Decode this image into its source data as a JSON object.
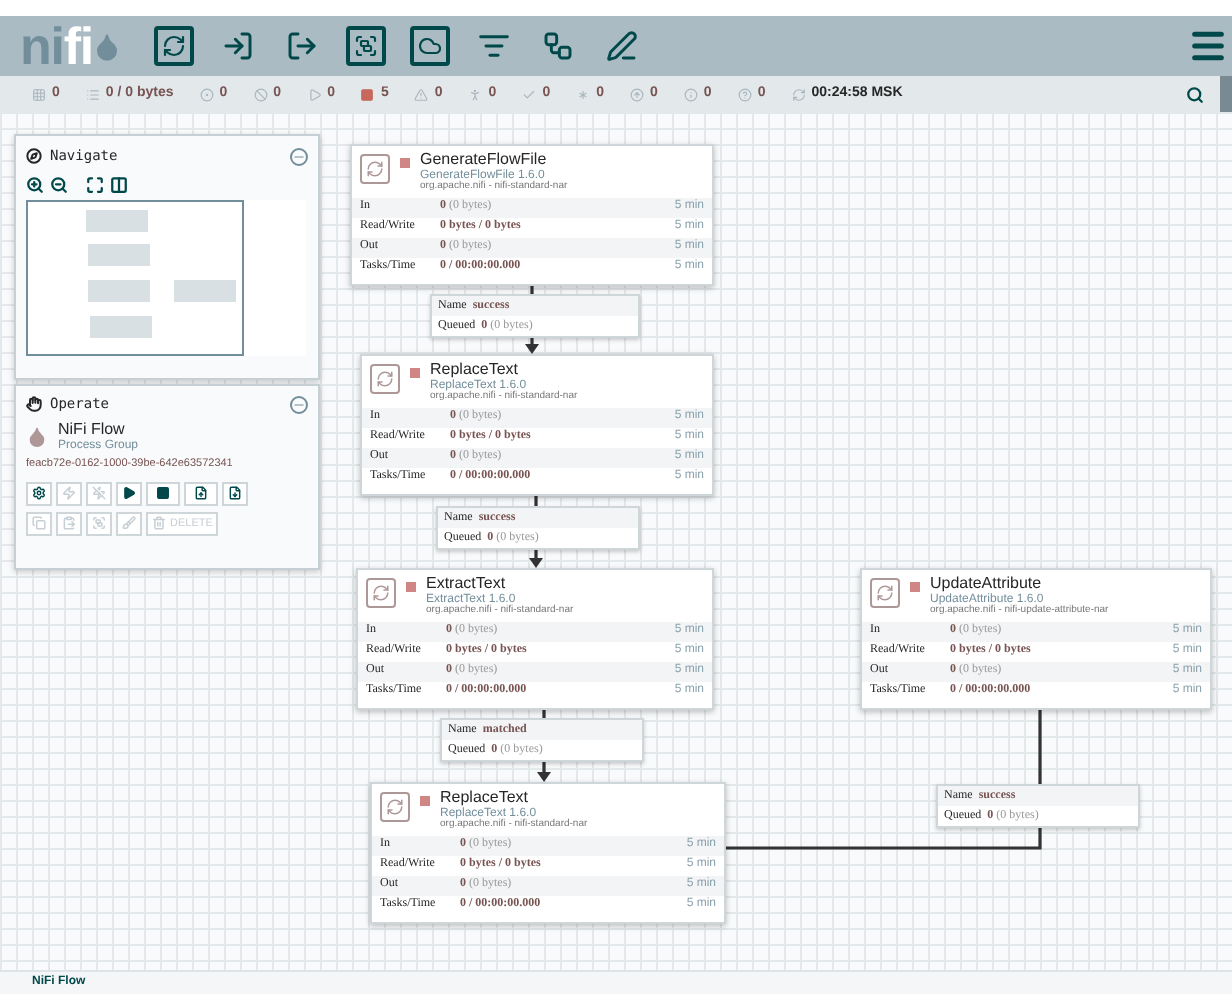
{
  "logo": {
    "dark": "ni",
    "light": "fi"
  },
  "status": [
    {
      "kind": "threads",
      "text": "0"
    },
    {
      "kind": "queued",
      "text": "0 / 0 bytes"
    },
    {
      "kind": "transmitting",
      "text": "0"
    },
    {
      "kind": "not_transmitting",
      "text": "0"
    },
    {
      "kind": "running",
      "text": "0"
    },
    {
      "kind": "stopped",
      "text": "5"
    },
    {
      "kind": "invalid",
      "text": "0"
    },
    {
      "kind": "disabled",
      "text": "0"
    },
    {
      "kind": "up_to_date",
      "text": "0"
    },
    {
      "kind": "locally_modified",
      "text": "0"
    },
    {
      "kind": "stale",
      "text": "0"
    },
    {
      "kind": "modified_stale",
      "text": "0"
    },
    {
      "kind": "sync_failure",
      "text": "0"
    },
    {
      "kind": "refresh",
      "text": "00:24:58 MSK"
    }
  ],
  "navigate": {
    "title": "Navigate"
  },
  "operate": {
    "title": "Operate",
    "name": "NiFi Flow",
    "type": "Process Group",
    "id": "feacb72e-0162-1000-39be-642e63572341",
    "buttons": [
      {
        "kind": "configure",
        "disabled": false
      },
      {
        "kind": "enable",
        "disabled": true
      },
      {
        "kind": "disable",
        "disabled": true
      },
      {
        "kind": "start",
        "disabled": false
      },
      {
        "kind": "stop",
        "disabled": false
      },
      {
        "kind": "create_template",
        "disabled": false
      },
      {
        "kind": "upload_template",
        "disabled": false
      },
      {
        "kind": "copy",
        "disabled": true
      },
      {
        "kind": "paste",
        "disabled": true
      },
      {
        "kind": "group",
        "disabled": true
      },
      {
        "kind": "color",
        "disabled": true
      },
      {
        "kind": "delete",
        "disabled": true,
        "label": "DELETE"
      }
    ]
  },
  "processors": [
    {
      "name": "GenerateFlowFile",
      "type": "GenerateFlowFile 1.6.0",
      "bundle": "org.apache.nifi - nifi-standard-nar",
      "stopped": true,
      "stats": [
        {
          "label": "In",
          "value": "0",
          "detail": "(0 bytes)",
          "window": "5 min"
        },
        {
          "label": "Read/Write",
          "value": "0 bytes / 0 bytes",
          "window": "5 min"
        },
        {
          "label": "Out",
          "value": "0",
          "detail": "(0 bytes)",
          "window": "5 min"
        },
        {
          "label": "Tasks/Time",
          "value": "0 / 00:00:00.000",
          "window": "5 min"
        }
      ]
    },
    {
      "name": "ReplaceText",
      "type": "ReplaceText 1.6.0",
      "bundle": "org.apache.nifi - nifi-standard-nar",
      "stopped": true,
      "stats": [
        {
          "label": "In",
          "value": "0",
          "detail": "(0 bytes)",
          "window": "5 min"
        },
        {
          "label": "Read/Write",
          "value": "0 bytes / 0 bytes",
          "window": "5 min"
        },
        {
          "label": "Out",
          "value": "0",
          "detail": "(0 bytes)",
          "window": "5 min"
        },
        {
          "label": "Tasks/Time",
          "value": "0 / 00:00:00.000",
          "window": "5 min"
        }
      ]
    },
    {
      "name": "ExtractText",
      "type": "ExtractText 1.6.0",
      "bundle": "org.apache.nifi - nifi-standard-nar",
      "stopped": true,
      "stats": [
        {
          "label": "In",
          "value": "0",
          "detail": "(0 bytes)",
          "window": "5 min"
        },
        {
          "label": "Read/Write",
          "value": "0 bytes / 0 bytes",
          "window": "5 min"
        },
        {
          "label": "Out",
          "value": "0",
          "detail": "(0 bytes)",
          "window": "5 min"
        },
        {
          "label": "Tasks/Time",
          "value": "0 / 00:00:00.000",
          "window": "5 min"
        }
      ]
    },
    {
      "name": "ReplaceText",
      "type": "ReplaceText 1.6.0",
      "bundle": "org.apache.nifi - nifi-standard-nar",
      "stopped": true,
      "stats": [
        {
          "label": "In",
          "value": "0",
          "detail": "(0 bytes)",
          "window": "5 min"
        },
        {
          "label": "Read/Write",
          "value": "0 bytes / 0 bytes",
          "window": "5 min"
        },
        {
          "label": "Out",
          "value": "0",
          "detail": "(0 bytes)",
          "window": "5 min"
        },
        {
          "label": "Tasks/Time",
          "value": "0 / 00:00:00.000",
          "window": "5 min"
        }
      ]
    },
    {
      "name": "UpdateAttribute",
      "type": "UpdateAttribute 1.6.0",
      "bundle": "org.apache.nifi - nifi-update-attribute-nar",
      "stopped": true,
      "stats": [
        {
          "label": "In",
          "value": "0",
          "detail": "(0 bytes)",
          "window": "5 min"
        },
        {
          "label": "Read/Write",
          "value": "0 bytes / 0 bytes",
          "window": "5 min"
        },
        {
          "label": "Out",
          "value": "0",
          "detail": "(0 bytes)",
          "window": "5 min"
        },
        {
          "label": "Tasks/Time",
          "value": "0 / 00:00:00.000",
          "window": "5 min"
        }
      ]
    }
  ],
  "connections": [
    {
      "name_label": "Name",
      "name": "success",
      "queued_label": "Queued",
      "queued": "0",
      "queued_detail": "(0 bytes)"
    },
    {
      "name_label": "Name",
      "name": "success",
      "queued_label": "Queued",
      "queued": "0",
      "queued_detail": "(0 bytes)"
    },
    {
      "name_label": "Name",
      "name": "matched",
      "queued_label": "Queued",
      "queued": "0",
      "queued_detail": "(0 bytes)"
    },
    {
      "name_label": "Name",
      "name": "success",
      "queued_label": "Queued",
      "queued": "0",
      "queued_detail": "(0 bytes)"
    }
  ],
  "breadcrumb": "NiFi Flow"
}
